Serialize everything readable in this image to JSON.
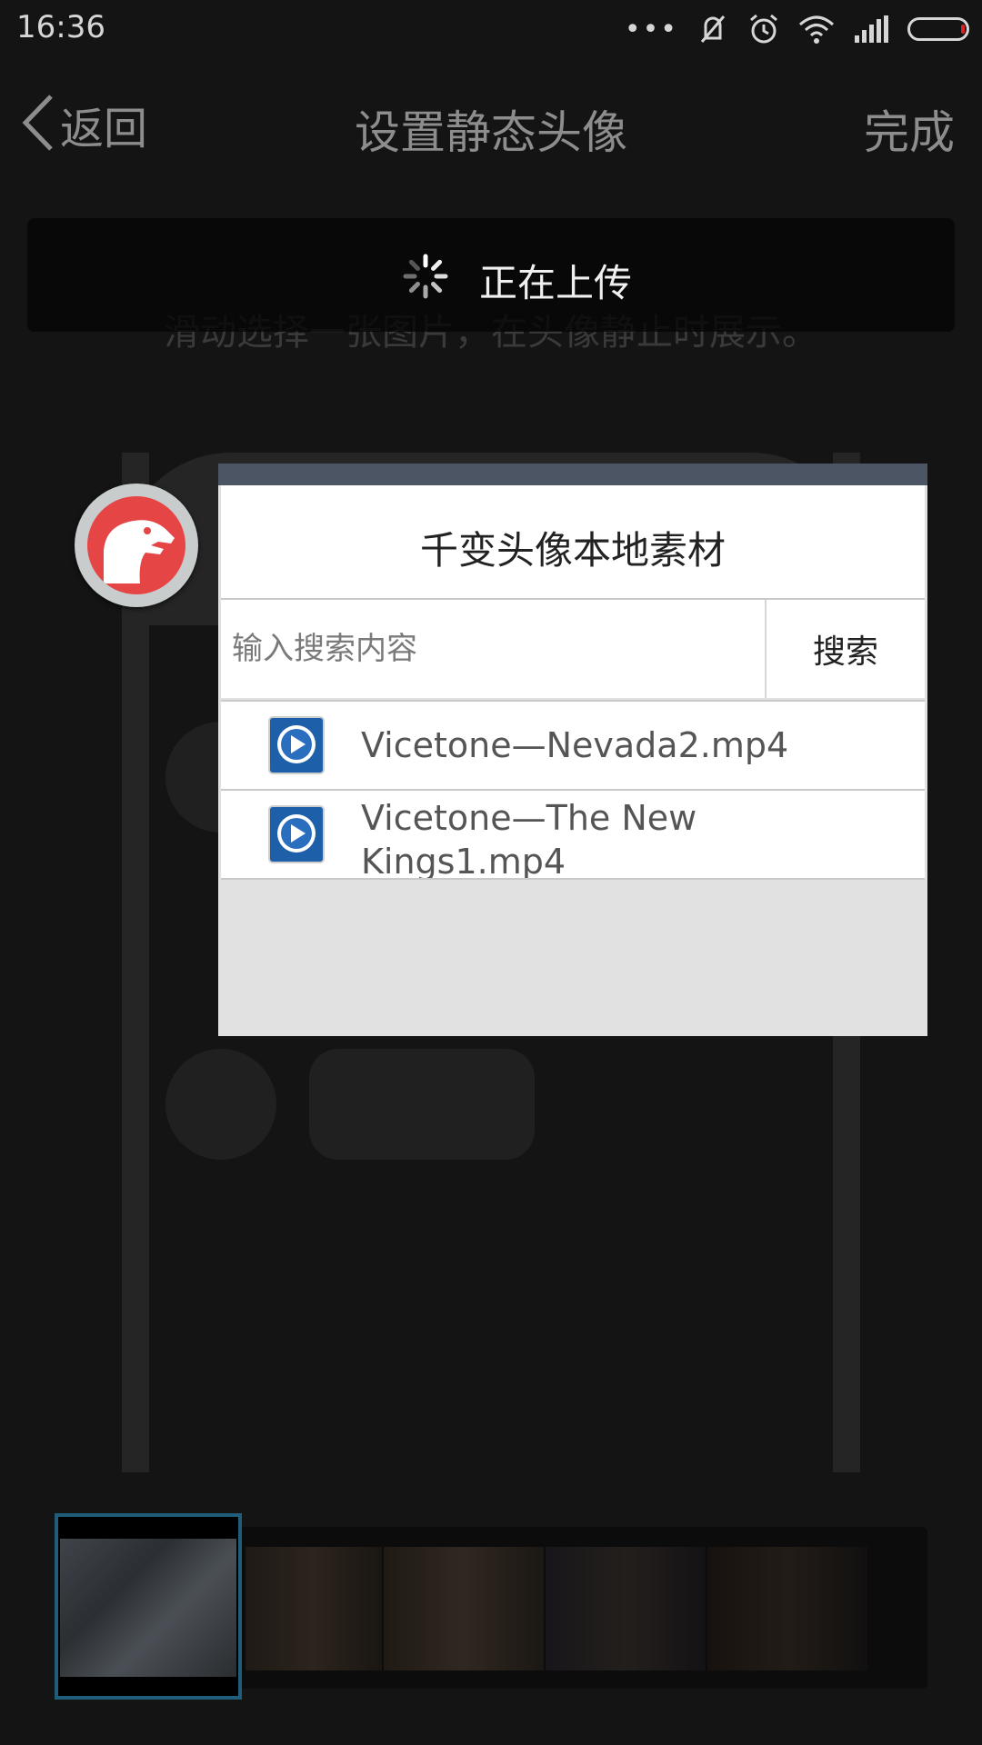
{
  "status_bar": {
    "time": "16:36",
    "dots": "•••"
  },
  "title_bar": {
    "back_label": "返回",
    "title": "设置静态头像",
    "done_label": "完成"
  },
  "toast": {
    "text": "正在上传"
  },
  "hint": "滑动选择一张图片，在头像静止时展示。",
  "dialog": {
    "title": "千变头像本地素材",
    "search_placeholder": "输入搜索内容",
    "search_button": "搜索",
    "files": [
      {
        "name": "Vicetone—Nevada2.mp4",
        "icon": "video-file-icon"
      },
      {
        "name": "Vicetone—The New Kings1.mp4",
        "icon": "video-file-icon"
      }
    ]
  },
  "colors": {
    "accent": "#205d7a",
    "dialog_header": "#4b5563",
    "app_icon": "#e64545"
  }
}
